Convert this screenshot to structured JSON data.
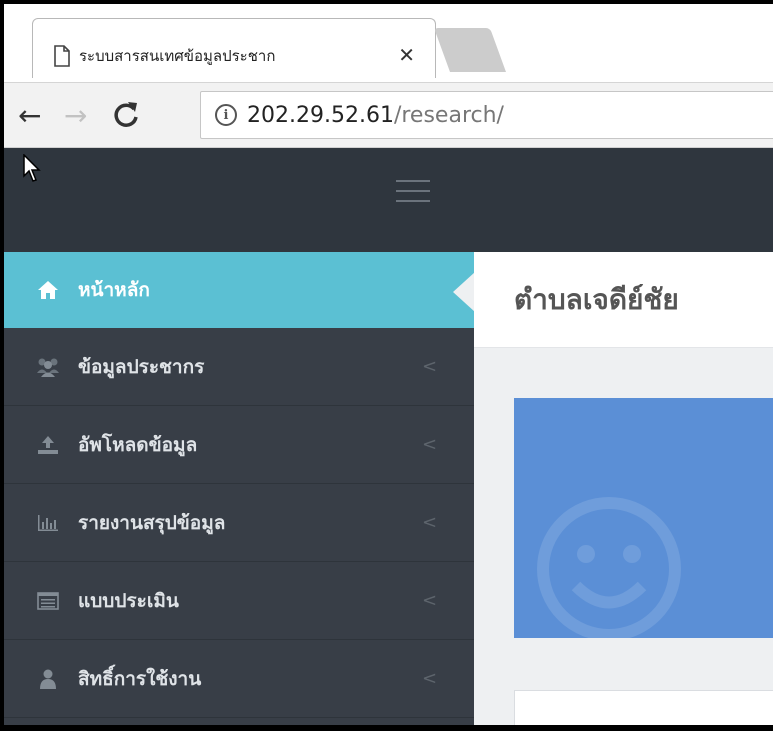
{
  "browser": {
    "tab_title": "ระบบสารสนเทศข้อมูลประชาก",
    "tab_close": "✕",
    "url_host": "202.29.52.61",
    "url_path": "/research/",
    "icons": [
      "page-icon",
      "back-arrow-icon",
      "forward-arrow-icon",
      "reload-icon",
      "info-icon",
      "close-icon"
    ]
  },
  "sidebar": {
    "items": [
      {
        "label": "หน้าหลัก",
        "icon": "home-icon",
        "active": true
      },
      {
        "label": "ข้อมูลประชากร",
        "icon": "users-icon",
        "active": false
      },
      {
        "label": "อัพโหลดข้อมูล",
        "icon": "upload-icon",
        "active": false
      },
      {
        "label": "รายงานสรุปข้อมูล",
        "icon": "bar-chart-icon",
        "active": false
      },
      {
        "label": "แบบประเมิน",
        "icon": "list-icon",
        "active": false
      },
      {
        "label": "สิทธิ์การใช้งาน",
        "icon": "user-icon",
        "active": false
      }
    ],
    "chevron": "<"
  },
  "content": {
    "title": "ตำบลเจดีย์ชัย"
  },
  "colors": {
    "header_bg": "#2f363e",
    "sidebar_bg": "#383e47",
    "active_bg": "#5bc0d3",
    "card_bg": "#5b8fd6"
  }
}
